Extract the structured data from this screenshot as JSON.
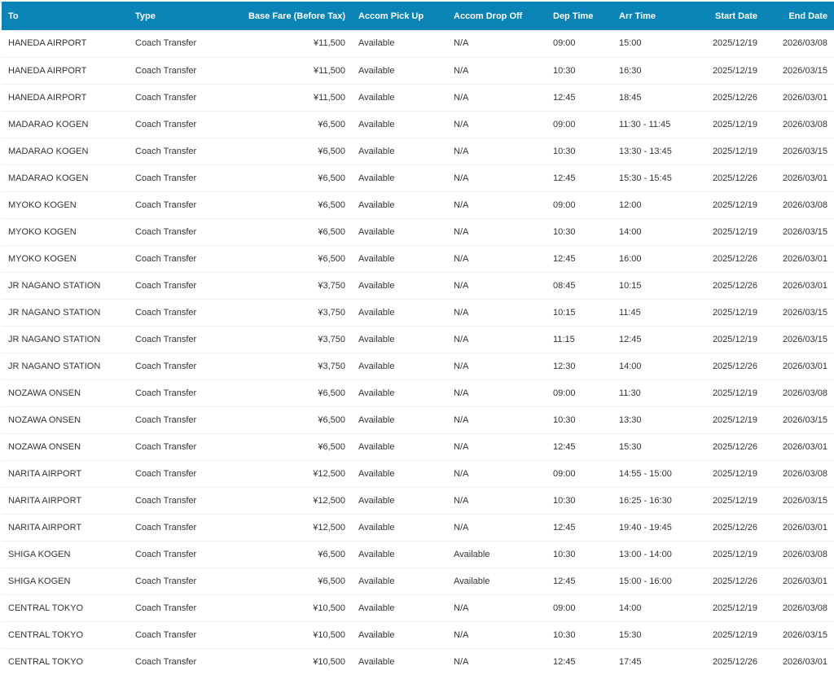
{
  "table": {
    "headers": [
      "To",
      "Type",
      "Base Fare (Before Tax)",
      "Accom Pick Up",
      "Accom Drop Off",
      "Dep Time",
      "Arr Time",
      "Start Date",
      "End Date"
    ],
    "rows": [
      [
        "HANEDA AIRPORT",
        "Coach Transfer",
        "¥11,500",
        "Available",
        "N/A",
        "09:00",
        "15:00",
        "2025/12/19",
        "2026/03/08"
      ],
      [
        "HANEDA AIRPORT",
        "Coach Transfer",
        "¥11,500",
        "Available",
        "N/A",
        "10:30",
        "16:30",
        "2025/12/19",
        "2026/03/15"
      ],
      [
        "HANEDA AIRPORT",
        "Coach Transfer",
        "¥11,500",
        "Available",
        "N/A",
        "12:45",
        "18:45",
        "2025/12/26",
        "2026/03/01"
      ],
      [
        "MADARAO KOGEN",
        "Coach Transfer",
        "¥6,500",
        "Available",
        "N/A",
        "09:00",
        "11:30 - 11:45",
        "2025/12/19",
        "2026/03/08"
      ],
      [
        "MADARAO KOGEN",
        "Coach Transfer",
        "¥6,500",
        "Available",
        "N/A",
        "10:30",
        "13:30 - 13:45",
        "2025/12/19",
        "2026/03/15"
      ],
      [
        "MADARAO KOGEN",
        "Coach Transfer",
        "¥6,500",
        "Available",
        "N/A",
        "12:45",
        "15:30 - 15:45",
        "2025/12/26",
        "2026/03/01"
      ],
      [
        "MYOKO KOGEN",
        "Coach Transfer",
        "¥6,500",
        "Available",
        "N/A",
        "09:00",
        "12:00",
        "2025/12/19",
        "2026/03/08"
      ],
      [
        "MYOKO KOGEN",
        "Coach Transfer",
        "¥6,500",
        "Available",
        "N/A",
        "10:30",
        "14:00",
        "2025/12/19",
        "2026/03/15"
      ],
      [
        "MYOKO KOGEN",
        "Coach Transfer",
        "¥6,500",
        "Available",
        "N/A",
        "12:45",
        "16:00",
        "2025/12/26",
        "2026/03/01"
      ],
      [
        "JR NAGANO STATION",
        "Coach Transfer",
        "¥3,750",
        "Available",
        "N/A",
        "08:45",
        "10:15",
        "2025/12/26",
        "2026/03/01"
      ],
      [
        "JR NAGANO STATION",
        "Coach Transfer",
        "¥3,750",
        "Available",
        "N/A",
        "10:15",
        "11:45",
        "2025/12/19",
        "2026/03/15"
      ],
      [
        "JR NAGANO STATION",
        "Coach Transfer",
        "¥3,750",
        "Available",
        "N/A",
        "11:15",
        "12:45",
        "2025/12/19",
        "2026/03/15"
      ],
      [
        "JR NAGANO STATION",
        "Coach Transfer",
        "¥3,750",
        "Available",
        "N/A",
        "12:30",
        "14:00",
        "2025/12/26",
        "2026/03/01"
      ],
      [
        "NOZAWA ONSEN",
        "Coach Transfer",
        "¥6,500",
        "Available",
        "N/A",
        "09:00",
        "11:30",
        "2025/12/19",
        "2026/03/08"
      ],
      [
        "NOZAWA ONSEN",
        "Coach Transfer",
        "¥6,500",
        "Available",
        "N/A",
        "10:30",
        "13:30",
        "2025/12/19",
        "2026/03/15"
      ],
      [
        "NOZAWA ONSEN",
        "Coach Transfer",
        "¥6,500",
        "Available",
        "N/A",
        "12:45",
        "15:30",
        "2025/12/26",
        "2026/03/01"
      ],
      [
        "NARITA AIRPORT",
        "Coach Transfer",
        "¥12,500",
        "Available",
        "N/A",
        "09:00",
        "14:55 - 15:00",
        "2025/12/19",
        "2026/03/08"
      ],
      [
        "NARITA AIRPORT",
        "Coach Transfer",
        "¥12,500",
        "Available",
        "N/A",
        "10:30",
        "16:25 - 16:30",
        "2025/12/19",
        "2026/03/15"
      ],
      [
        "NARITA AIRPORT",
        "Coach Transfer",
        "¥12,500",
        "Available",
        "N/A",
        "12:45",
        "19:40 - 19:45",
        "2025/12/26",
        "2026/03/01"
      ],
      [
        "SHIGA KOGEN",
        "Coach Transfer",
        "¥6,500",
        "Available",
        "Available",
        "10:30",
        "13:00 - 14:00",
        "2025/12/19",
        "2026/03/08"
      ],
      [
        "SHIGA KOGEN",
        "Coach Transfer",
        "¥6,500",
        "Available",
        "Available",
        "12:45",
        "15:00 - 16:00",
        "2025/12/26",
        "2026/03/01"
      ],
      [
        "CENTRAL TOKYO",
        "Coach Transfer",
        "¥10,500",
        "Available",
        "N/A",
        "09:00",
        "14:00",
        "2025/12/19",
        "2026/03/08"
      ],
      [
        "CENTRAL TOKYO",
        "Coach Transfer",
        "¥10,500",
        "Available",
        "N/A",
        "10:30",
        "15:30",
        "2025/12/19",
        "2026/03/15"
      ],
      [
        "CENTRAL TOKYO",
        "Coach Transfer",
        "¥10,500",
        "Available",
        "N/A",
        "12:45",
        "17:45",
        "2025/12/26",
        "2026/03/01"
      ]
    ]
  },
  "colors": {
    "header_background": "#0a83b6",
    "header_text": "#ffffff",
    "row_text": "#333333",
    "row_divider": "#efefef"
  }
}
